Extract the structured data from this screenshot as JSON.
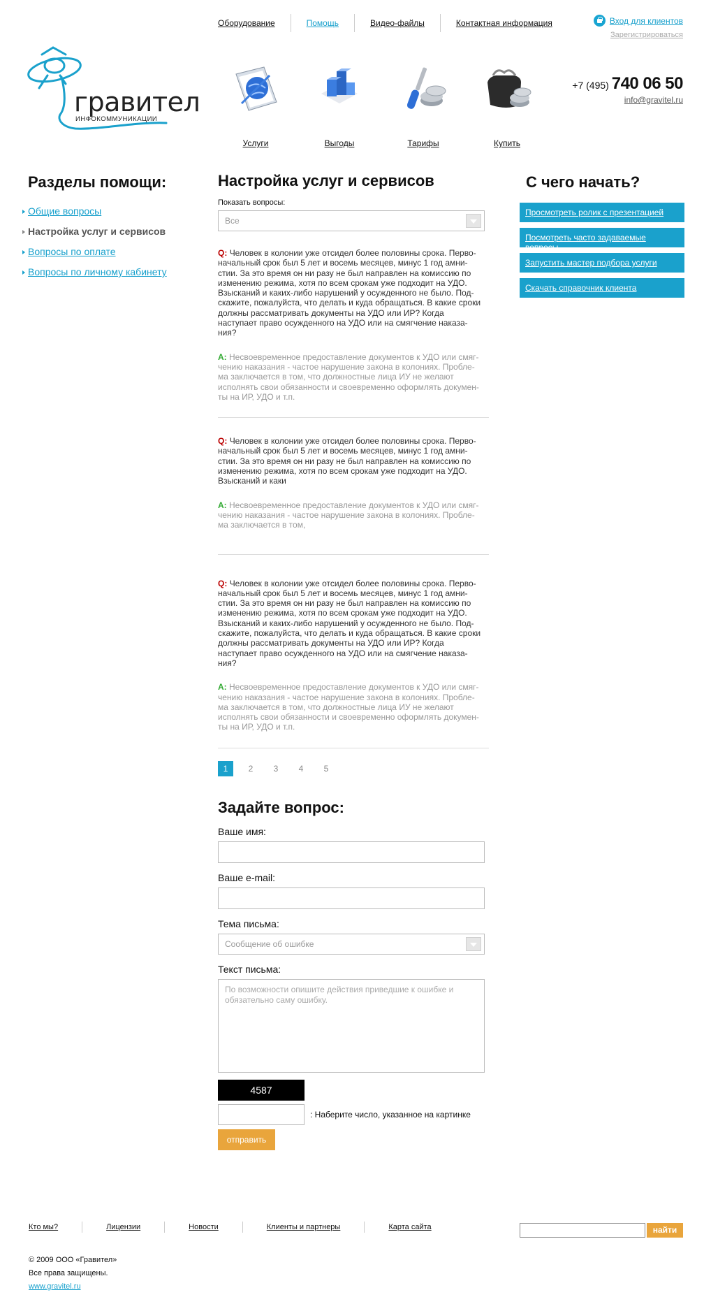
{
  "topnav": {
    "items": [
      "Оборудование",
      "Помощь",
      "Видео-файлы",
      "Контактная информация"
    ],
    "active_index": 1
  },
  "auth": {
    "login_label": "Вход для клиентов",
    "register_label": "Зарегистрироваться"
  },
  "logo": {
    "wordmark": "гравител",
    "subtitle": "ИНФОКОММУНИКАЦИИ",
    "color": "#1aa1cc"
  },
  "features": [
    {
      "label": "Услуги",
      "icon": "document-globe-icon"
    },
    {
      "label": "Выгоды",
      "icon": "blue-cubes-icon"
    },
    {
      "label": "Тарифы",
      "icon": "screwdriver-coins-icon"
    },
    {
      "label": "Купить",
      "icon": "wallet-coins-icon"
    }
  ],
  "contact": {
    "phone_code": "+7 (495)",
    "phone_number": "740 06 50",
    "email": "info@gravitel.ru"
  },
  "help_sections": {
    "title": "Разделы помощи:",
    "items": [
      "Общие вопросы",
      "Настройка услуг и сервисов",
      "Вопросы по оплате",
      "Вопросы по личному кабинету"
    ],
    "current_index": 1
  },
  "start": {
    "title": "С чего начать?",
    "links": [
      "Просмотреть ролик с презентацией",
      "Посмотреть часто задаваемые вопросы",
      "Запустить мастер подбора услуги",
      "Скачать справочник клиента"
    ]
  },
  "main": {
    "title": "Настройка услуг и сервисов",
    "filter_label": "Показать вопросы:",
    "filter_value": "Все",
    "q_marker": "Q:",
    "a_marker": "A:",
    "qa": [
      {
        "q": "Человек в колонии уже отсидел более половины срока. Перво-начальный срок был 5 лет и восемь месяцев, минус 1 год амни-стии. За это время он ни разу не был направлен на комиссию по изменению режима, хотя по всем срокам уже подходит на УДО. Взысканий и каких-либо нарушений у осужденного не было. Под-скажите, пожалуйста, что делать и куда обращаться. В какие сроки должны рассматривать документы на УДО или ИР? Когда наступает право осужденного на УДО или на смягчение наказа-ния?",
        "a": "Несвоевременное предоставление документов к УДО или смяг-чению наказания - частое нарушение закона в колониях. Пробле-ма заключается в том, что должностные лица ИУ не желают исполнять свои обязанности и своевременно оформлять докумен-ты на ИР, УДО и т.п."
      },
      {
        "q": "Человек в колонии уже отсидел более половины срока. Перво-начальный срок был 5 лет и восемь месяцев, минус 1 год амни-стии. За это время он ни разу не был направлен на комиссию по изменению режима, хотя по всем срокам уже подходит на УДО. Взысканий и каки",
        "a": "Несвоевременное предоставление документов к УДО или смяг-чению наказания - частое нарушение закона в колониях. Пробле-ма заключается в том,"
      },
      {
        "q": "Человек в колонии уже отсидел более половины срока. Перво-начальный срок был 5 лет и восемь месяцев, минус 1 год амни-стии. За это время он ни разу не был направлен на комиссию по изменению режима, хотя по всем срокам уже подходит на УДО. Взысканий и каких-либо нарушений у осужденного не было. Под-скажите, пожалуйста, что делать и куда обращаться. В какие сроки должны рассматривать документы на УДО или ИР? Когда наступает право осужденного на УДО или на смягчение наказа-ния?",
        "a": "Несвоевременное предоставление документов к УДО или смяг-чению наказания - частое нарушение закона в колониях. Пробле-ма заключается в том, что должностные лица ИУ не желают исполнять свои обязанности и своевременно оформлять докумен-ты на ИР, УДО и т.п."
      }
    ],
    "pages": [
      "1",
      "2",
      "3",
      "4",
      "5"
    ],
    "current_page": 0
  },
  "form": {
    "title": "Задайте вопрос:",
    "name_label": "Ваше имя:",
    "email_label": "Ваше e-mail:",
    "subject_label": "Тема письма:",
    "subject_value": "Сообщение об ошибке",
    "text_label": "Текст письма:",
    "text_placeholder": "По возможности опишите действия приведшие к ошибке и обязательно саму ошибку.",
    "captcha_code": "4587",
    "captcha_hint": ": Наберите число, указанное на картинке",
    "submit_label": "отправить"
  },
  "footer": {
    "links": [
      "Кто мы?",
      "Лицензии",
      "Новости",
      "Клиенты и партнеры",
      "Карта сайта"
    ],
    "search_button": "найти",
    "copyright": "© 2009 ООО «Гравител»",
    "rights": "Все права защищены.",
    "site": "www.gravitel.ru"
  },
  "colors": {
    "accent": "#1aa1cc",
    "button_orange": "#e9a53c",
    "question_marker": "#b00000",
    "answer_marker": "#33aa33"
  }
}
